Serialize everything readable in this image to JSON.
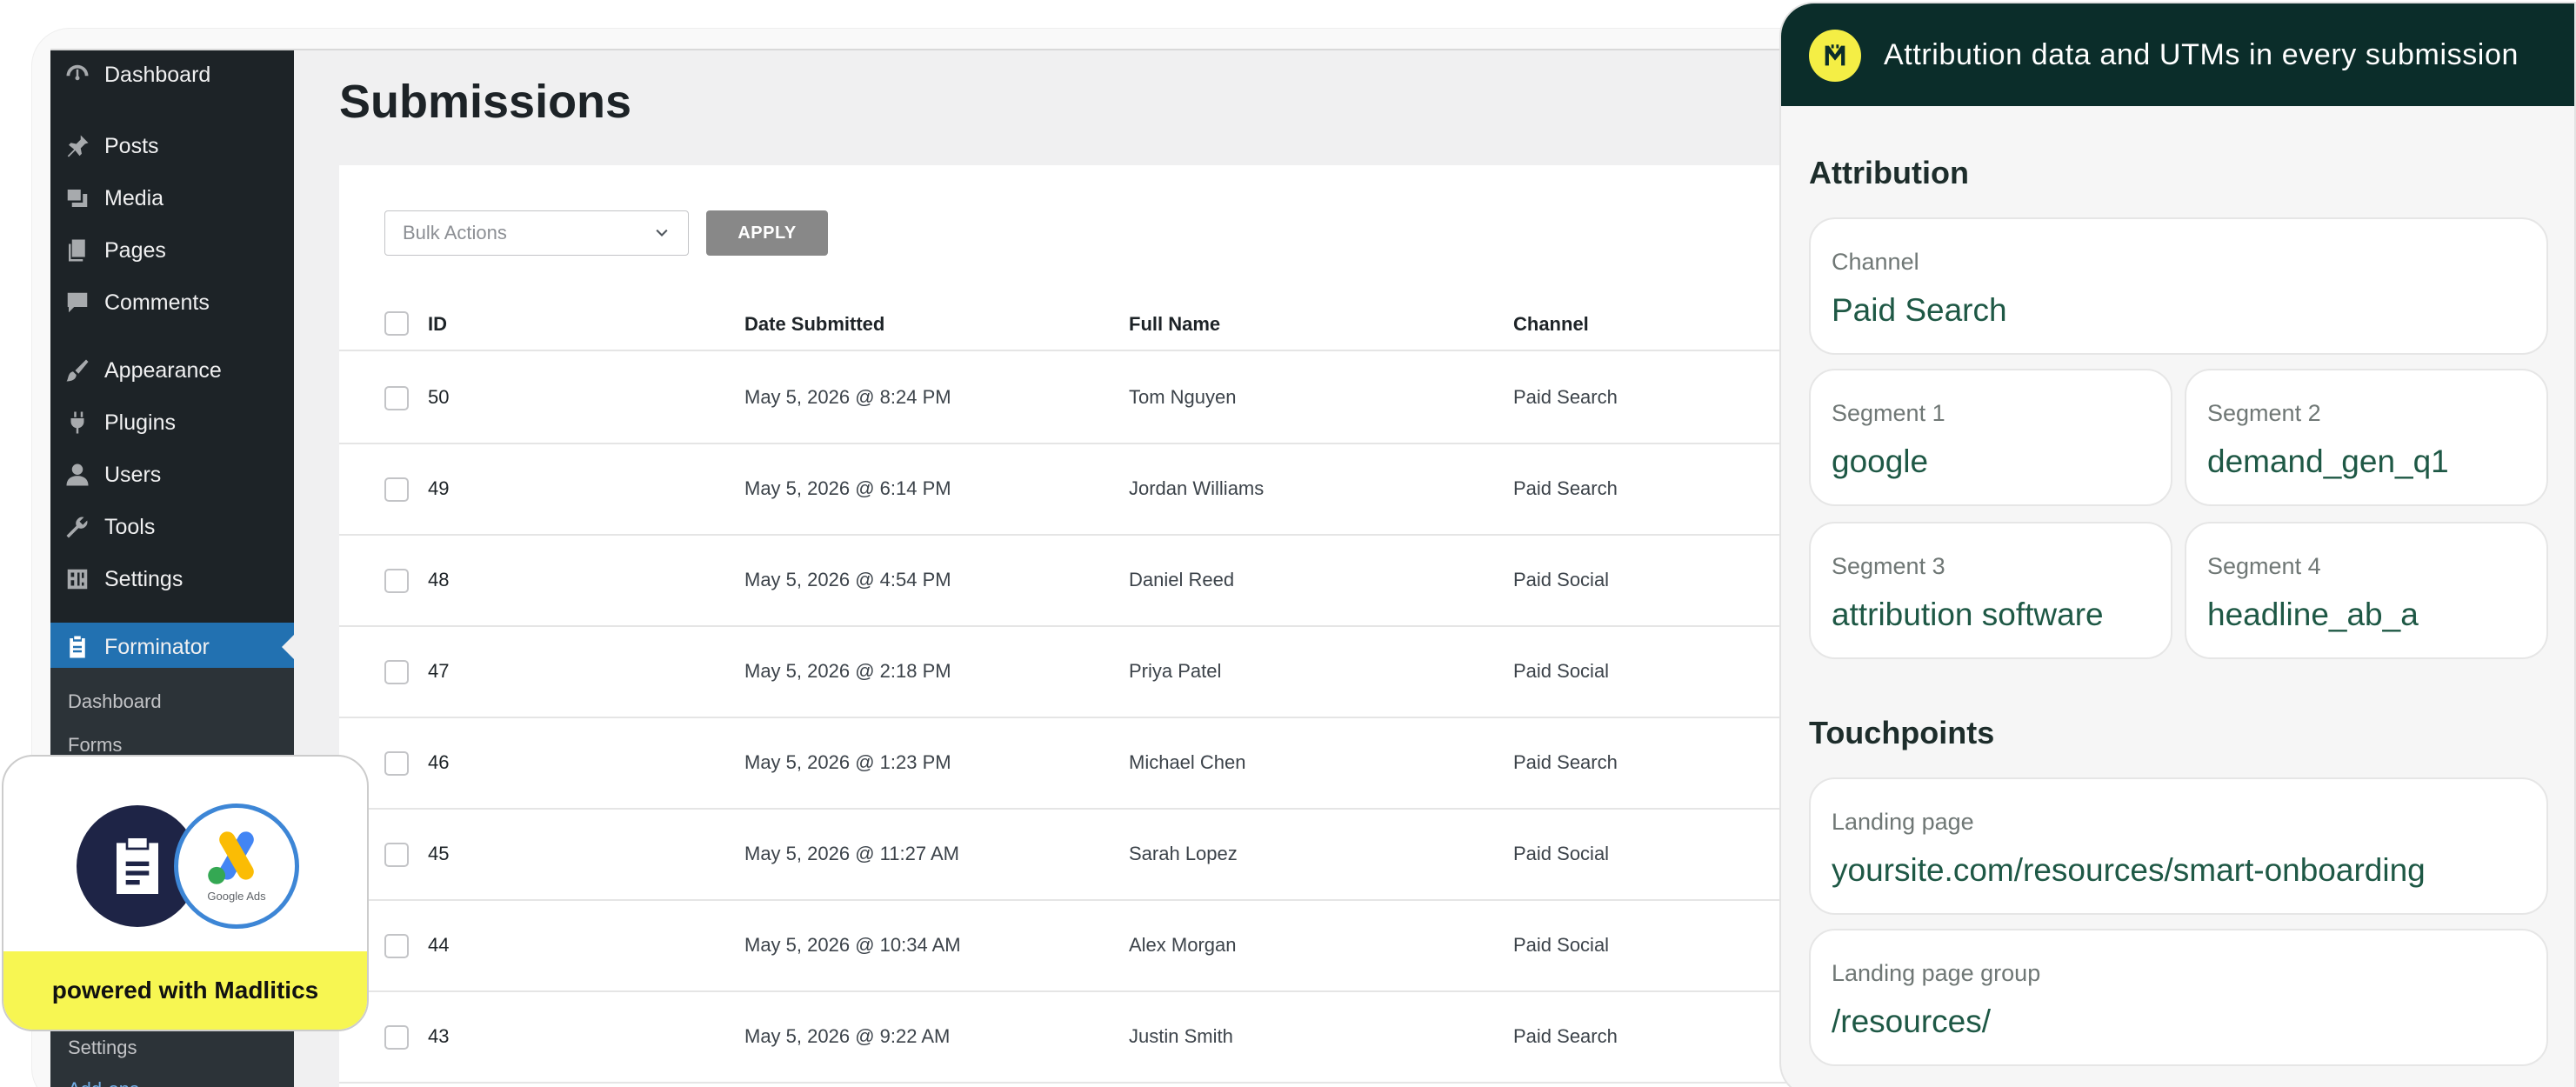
{
  "sidebar": {
    "items": [
      {
        "label": "Dashboard",
        "icon": "dashboard-icon"
      },
      {
        "label": "Posts",
        "icon": "pin-icon"
      },
      {
        "label": "Media",
        "icon": "media-icon"
      },
      {
        "label": "Pages",
        "icon": "pages-icon"
      },
      {
        "label": "Comments",
        "icon": "comment-icon"
      },
      {
        "label": "Appearance",
        "icon": "brush-icon"
      },
      {
        "label": "Plugins",
        "icon": "plug-icon"
      },
      {
        "label": "Users",
        "icon": "user-icon"
      },
      {
        "label": "Tools",
        "icon": "wrench-icon"
      },
      {
        "label": "Settings",
        "icon": "settings-icon"
      },
      {
        "label": "Forminator",
        "icon": "clipboard-icon"
      }
    ],
    "submenu": [
      "Dashboard",
      "Forms",
      "Settings",
      "Add-ons"
    ]
  },
  "main": {
    "title": "Submissions",
    "bulk_placeholder": "Bulk Actions",
    "apply_label": "APPLY",
    "columns": [
      "ID",
      "Date Submitted",
      "Full Name",
      "Channel"
    ],
    "rows": [
      {
        "id": "50",
        "date": "May 5, 2026 @ 8:24 PM",
        "name": "Tom Nguyen",
        "channel": "Paid Search"
      },
      {
        "id": "49",
        "date": "May 5, 2026 @ 6:14 PM",
        "name": "Jordan Williams",
        "channel": "Paid Search"
      },
      {
        "id": "48",
        "date": "May 5, 2026 @ 4:54 PM",
        "name": "Daniel Reed",
        "channel": "Paid Social"
      },
      {
        "id": "47",
        "date": "May 5, 2026 @ 2:18 PM",
        "name": "Priya Patel",
        "channel": "Paid Social"
      },
      {
        "id": "46",
        "date": "May 5, 2026 @ 1:23 PM",
        "name": "Michael Chen",
        "channel": "Paid Search"
      },
      {
        "id": "45",
        "date": "May 5, 2026 @ 11:27 AM",
        "name": "Sarah Lopez",
        "channel": "Paid Social"
      },
      {
        "id": "44",
        "date": "May 5, 2026 @ 10:34 AM",
        "name": "Alex Morgan",
        "channel": "Paid Social"
      },
      {
        "id": "43",
        "date": "May 5, 2026 @ 9:22 AM",
        "name": "Justin Smith",
        "channel": "Paid Search"
      }
    ]
  },
  "badge": {
    "google_ads_label": "Google Ads",
    "footer": "powered with Madlitics"
  },
  "panel": {
    "title": "Attribution data and UTMs in every submission",
    "attribution_heading": "Attribution",
    "channel": {
      "label": "Channel",
      "value": "Paid Search"
    },
    "segments": [
      {
        "label": "Segment 1",
        "value": "google"
      },
      {
        "label": "Segment 2",
        "value": "demand_gen_q1"
      },
      {
        "label": "Segment 3",
        "value": "attribution software"
      },
      {
        "label": "Segment 4",
        "value": "headline_ab_a"
      }
    ],
    "touchpoints_heading": "Touchpoints",
    "landing_page": {
      "label": "Landing page",
      "value": "yoursite.com/resources/smart-onboarding"
    },
    "landing_page_group": {
      "label": "Landing page group",
      "value": "/resources/"
    }
  },
  "colors": {
    "sidebar_bg": "#1d2327",
    "sidebar_active": "#2271b1",
    "panel_header": "#0b2d2a",
    "brand_yellow": "#f7f652",
    "field_value": "#1e5845"
  }
}
